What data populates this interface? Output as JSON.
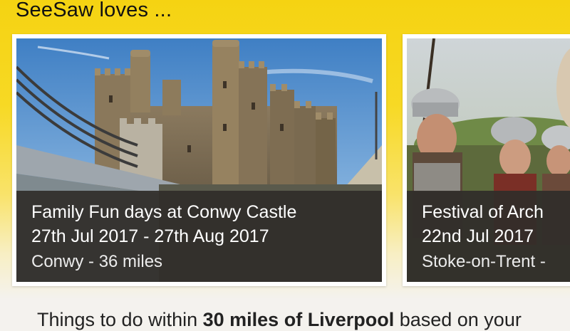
{
  "section": {
    "title": "SeeSaw loves ..."
  },
  "cards": [
    {
      "title": "Family Fun days at Conwy Castle",
      "date": "27th Jul 2017 - 27th Aug 2017",
      "location": "Conwy - 36 miles",
      "image": "castle-photo"
    },
    {
      "title": "Festival of Arch",
      "date": "22nd Jul 2017",
      "location": "Stoke-on-Trent -",
      "image": "reenactors-photo"
    }
  ],
  "intro": {
    "prefix": "Things to do within ",
    "emphasis": "30 miles of Liverpool",
    "suffix": " based on your"
  },
  "colors": {
    "banner": "#f5d312",
    "overlay": "#302d2a"
  }
}
